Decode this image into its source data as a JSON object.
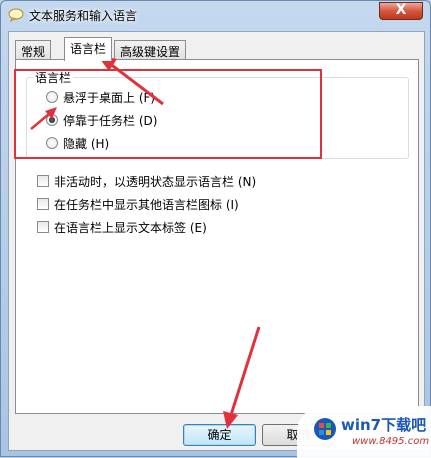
{
  "window": {
    "title": "文本服务和输入语言",
    "close_label": "X"
  },
  "tabs": [
    {
      "label": "常规"
    },
    {
      "label": "语言栏"
    },
    {
      "label": "高级键设置"
    }
  ],
  "language_bar_group": {
    "label": "语言栏",
    "options": [
      {
        "label": "悬浮于桌面上 (F)",
        "selected": false
      },
      {
        "label": "停靠于任务栏 (D)",
        "selected": true
      },
      {
        "label": "隐藏 (H)",
        "selected": false
      }
    ]
  },
  "checkboxes": [
    {
      "label": "非活动时，以透明状态显示语言栏 (N)",
      "checked": false
    },
    {
      "label": "在任务栏中显示其他语言栏图标 (I)",
      "checked": false
    },
    {
      "label": "在语言栏上显示文本标签 (E)",
      "checked": false
    }
  ],
  "buttons": {
    "ok": "确定",
    "cancel": "取消"
  },
  "watermark": {
    "brand": "win7下载吧",
    "url": "www.8495.com"
  },
  "colors": {
    "annotation_red": "#e0323c",
    "accent_blue": "#3c7fb1"
  }
}
